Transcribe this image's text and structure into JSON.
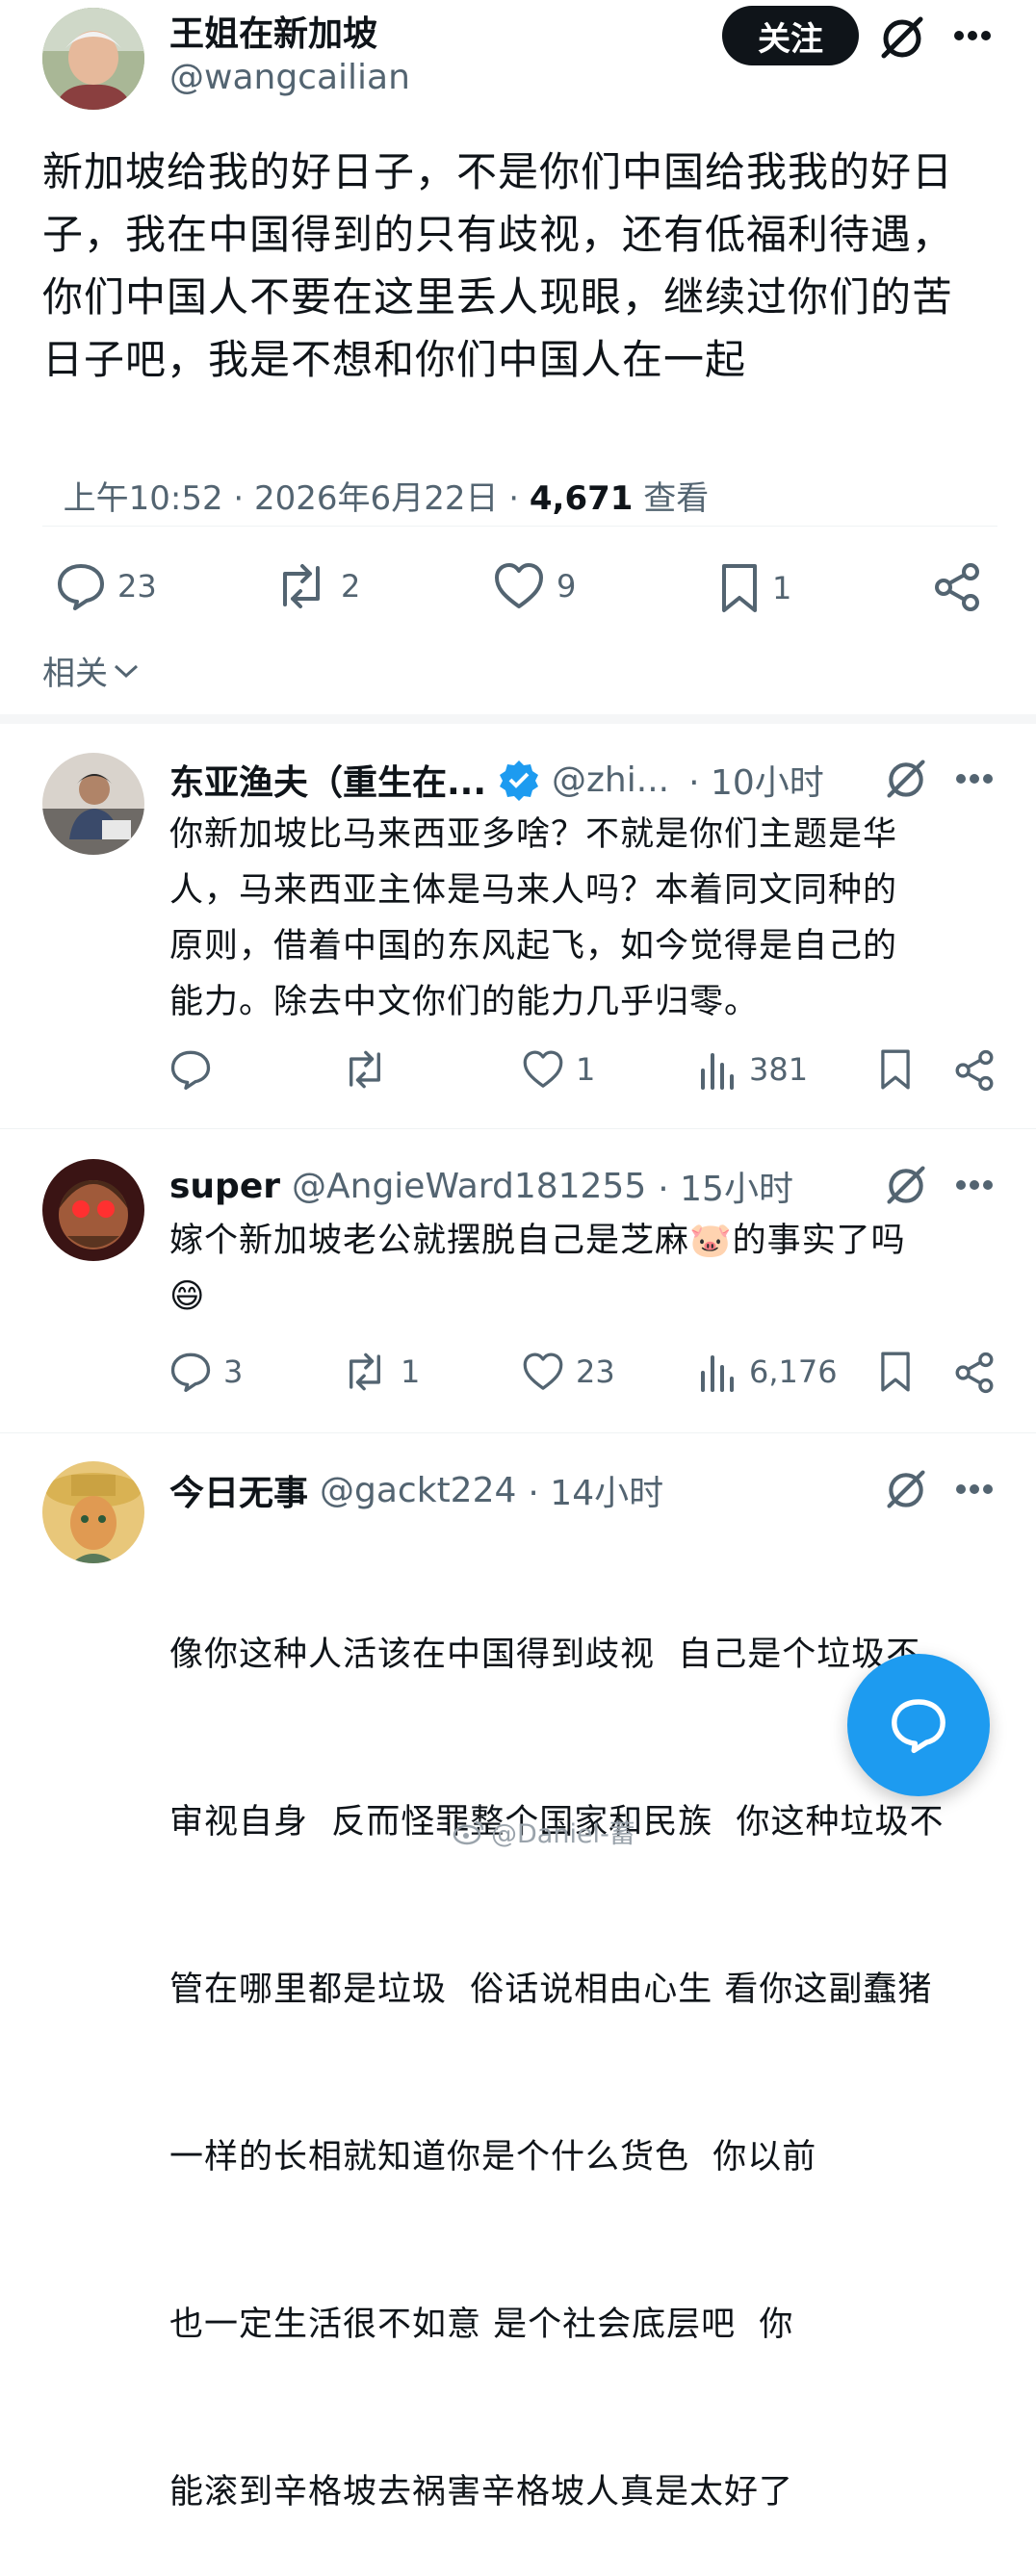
{
  "post": {
    "author_name": "王姐在新加坡",
    "author_handle": "@wangcailian",
    "follow_label": "关注",
    "text_lines": [
      "新加坡给我的好日子，不是你们中国给我我的好日",
      "子，我在中国得到的只有歧视，还有低福利待遇，",
      "你们中国人不要在这里丢人现眼，继续过你们的苦",
      "日子吧，我是不想和你们中国人在一起"
    ],
    "time": "上午10:52 · 2026年6月22日 · ",
    "views_count": "4,671",
    "views_label": " 查看",
    "replies": "23",
    "reposts": "2",
    "likes": "9",
    "bookmarks": "1",
    "related_label": "相关"
  },
  "replies": [
    {
      "name": "东亚渔夫（重生在...",
      "handle": "@zhi...",
      "time": "· 10小时",
      "verified": true,
      "text_lines": [
        "你新加坡比马来西亚多啥？不就是你们主题是华",
        "人，马来西亚主体是马来人吗？本着同文同种的",
        "原则，借着中国的东风起飞，如今觉得是自己的",
        "能力。除去中文你们的能力几乎归零。"
      ],
      "replies": "",
      "reposts": "",
      "likes": "1",
      "views": "381"
    },
    {
      "name": "super",
      "handle": "@AngieWard181255",
      "time": "· 15小时",
      "text_line1": "嫁个新加坡老公就摆脱自己是芝麻",
      "text_line1_end": "的事实了吗",
      "emoji_pig": "🐷",
      "emoji_grin": "😄",
      "replies": "3",
      "reposts": "1",
      "likes": "23",
      "views": "6,176"
    },
    {
      "name": "今日无事",
      "handle": "@gackt224",
      "time": "· 14小时",
      "text_lines": [
        "像你这种人活该在中国得到歧视  自己是个垃圾不",
        "审视自身  反而怪罪整个国家和民族  你这种垃圾不",
        "管在哪里都是垃圾  俗话说相由心生 看你这副蠢猪",
        "一样的长相就知道你是个什么货色  你以前",
        "也一定生活很不如意 是个社会底层吧  你",
        "能滚到辛格坡去祸害辛格坡人真是太好了"
      ]
    }
  ],
  "watermark": "@Daniel-蓄",
  "colors": {
    "accent": "#1d9bf0",
    "text": "#0f1419",
    "secondary": "#536471"
  }
}
